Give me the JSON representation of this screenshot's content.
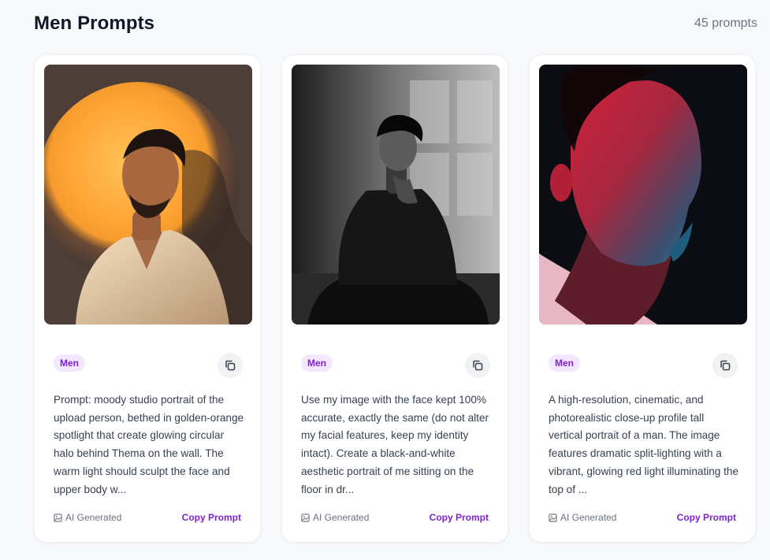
{
  "header": {
    "title": "Men Prompts",
    "count": "45 prompts"
  },
  "colors": {
    "accent": "#7e22ce",
    "badge_bg": "#f3e8ff",
    "text_muted": "#6b7280"
  },
  "cards": [
    {
      "image_subject": "man with closed eyes before a glowing orange circular halo",
      "category": "Men",
      "prompt": "Prompt: moody studio portrait of the upload person, bethed in golden-orange spotlight that create glowing circular halo behind Thema on the wall. The warm light should sculpt the face and upper body w...",
      "ai_label": "AI Generated",
      "copy_label": "Copy Prompt",
      "copy_icon": "copy-icon",
      "ai_icon": "image-icon"
    },
    {
      "image_subject": "black and white portrait of a man sitting on the floor with window shadows",
      "category": "Men",
      "prompt": "Use my image with the face kept 100% accurate, exactly the same (do not alter my facial features, keep my identity intact). Create a black-and-white aesthetic portrait of me sitting on the floor in dr...",
      "ai_label": "AI Generated",
      "copy_label": "Copy Prompt",
      "copy_icon": "copy-icon",
      "ai_icon": "image-icon"
    },
    {
      "image_subject": "close-up profile of a man lit by red and blue light",
      "category": "Men",
      "prompt": "A high-resolution, cinematic, and photorealistic close-up profile tall vertical portrait of a man. The image features dramatic split-lighting with a vibrant, glowing red light illuminating the top of ...",
      "ai_label": "AI Generated",
      "copy_label": "Copy Prompt",
      "copy_icon": "copy-icon",
      "ai_icon": "image-icon"
    }
  ]
}
